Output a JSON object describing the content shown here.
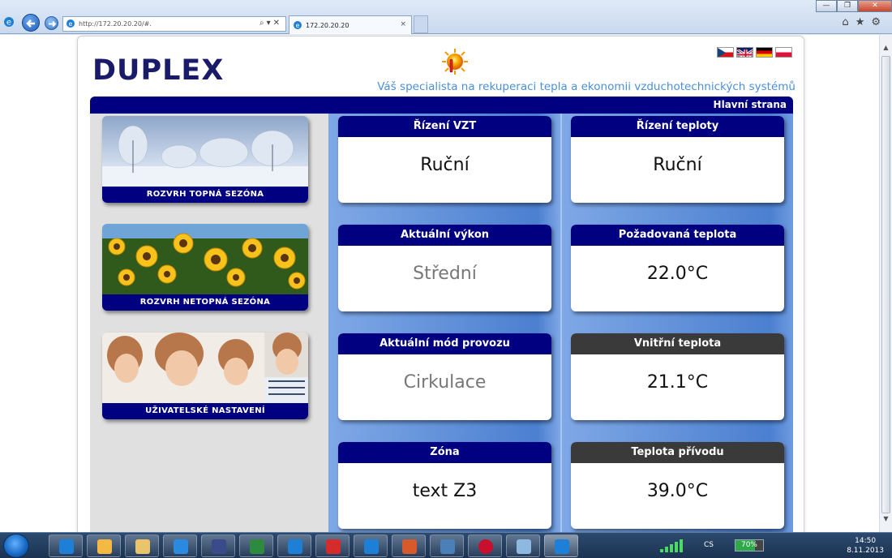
{
  "browser": {
    "address": "http://172.20.20.20/#.",
    "tab_title": "172.20.20.20",
    "tab_close": "×"
  },
  "header": {
    "logo": "DUPLEX",
    "slogan": "Váš specialista na rekuperaci tepla a ekonomii vzduchotechnických systémů",
    "page_title": "Hlavní strana",
    "flags": [
      "cz",
      "gb",
      "de",
      "pl"
    ]
  },
  "left_menu": {
    "items": [
      {
        "label": "ROZVRH TOPNÁ SEZÓNA",
        "image": "winter-landscape"
      },
      {
        "label": "ROZVRH NETOPNÁ SEZÓNA",
        "image": "sunflower-field"
      },
      {
        "label": "UŽIVATELSKÉ NASTAVENÍ",
        "image": "family-photo"
      }
    ]
  },
  "cards": {
    "rizeni_vzt": {
      "title": "Řízení VZT",
      "value": "Ruční"
    },
    "rizeni_teploty": {
      "title": "Řízení teploty",
      "value": "Ruční"
    },
    "aktualni_vykon": {
      "title": "Aktuální výkon",
      "value": "Střední"
    },
    "pozadovana_teplota": {
      "title": "Požadovaná teplota",
      "value": "22.0°C"
    },
    "aktualni_mod": {
      "title": "Aktuální mód provozu",
      "value": "Cirkulace"
    },
    "vnitrni_teplota": {
      "title": "Vnitřní teplota",
      "value": "21.1°C"
    },
    "zona": {
      "title": "Zóna",
      "value": "text Z3"
    },
    "teplota_privodu": {
      "title": "Teplota přívodu",
      "value": "39.0°C"
    }
  },
  "colors": {
    "navy": "#000080",
    "dark_header": "#3a3a3a",
    "slogan": "#4a8fd6",
    "panel_blue": "#4b7fd0"
  },
  "taskbar": {
    "language": "CS",
    "battery": "70%",
    "time": "14:50",
    "date": "8.11.2013"
  }
}
